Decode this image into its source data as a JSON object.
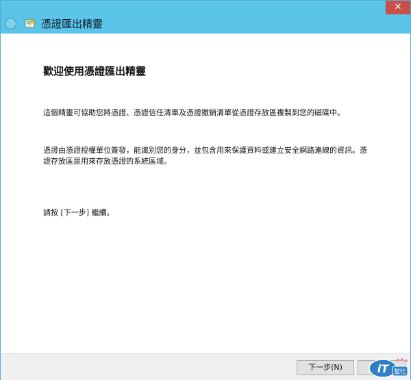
{
  "window": {
    "title": "憑證匯出精靈",
    "close_label": "✕"
  },
  "page": {
    "heading": "歡迎使用憑證匯出精靈",
    "paragraph_1": "這個精靈可協助您將憑證、憑證信任清單及憑證撤銷清單從憑證存放區複製到您的磁碟中。",
    "paragraph_2": "憑證由憑證授權單位簽發，能識別您的身分，並包含用來保護資料或建立安全網路連線的資訊。憑證存放區是用來存放憑證的系統區域。",
    "paragraph_3": "請按 [下一步] 繼續。"
  },
  "footer": {
    "next_label": "下一步(N)",
    "cancel_label": ""
  },
  "watermark": {
    "logo_text": "iT",
    "sub_text": "幫忙"
  },
  "icons": {
    "back": "back-arrow-icon",
    "wizard": "certificate-wizard-icon",
    "close": "close-icon"
  },
  "colors": {
    "titlebar": "#5bc4e9",
    "close_button": "#c7504a",
    "footer": "#f0f0f0"
  }
}
